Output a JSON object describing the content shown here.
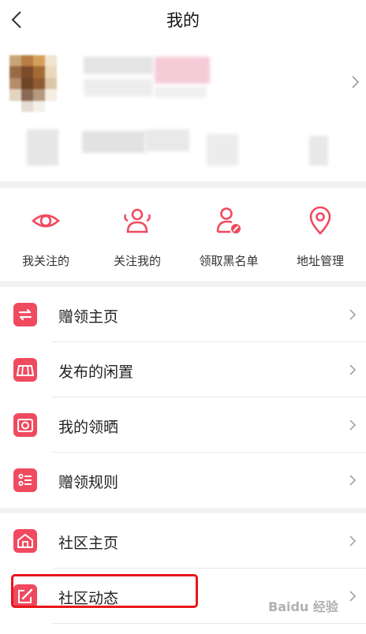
{
  "header": {
    "title": "我的"
  },
  "quick_actions": [
    {
      "label": "我关注的",
      "icon": "eye-icon"
    },
    {
      "label": "关注我的",
      "icon": "followers-icon"
    },
    {
      "label": "领取黑名单",
      "icon": "user-block-icon"
    },
    {
      "label": "地址管理",
      "icon": "location-pin-icon"
    }
  ],
  "menu_group_1": [
    {
      "label": "赠领主页",
      "icon": "exchange-icon"
    },
    {
      "label": "发布的闲置",
      "icon": "stall-icon"
    },
    {
      "label": "我的领晒",
      "icon": "camera-icon"
    },
    {
      "label": "赠领规则",
      "icon": "rules-list-icon"
    }
  ],
  "menu_group_2": [
    {
      "label": "社区主页",
      "icon": "home-icon"
    },
    {
      "label": "社区动态",
      "icon": "edit-icon"
    }
  ],
  "colors": {
    "accent": "#f04a5f",
    "highlight_box": "#e8161a"
  },
  "watermark": "Baidu 经验"
}
